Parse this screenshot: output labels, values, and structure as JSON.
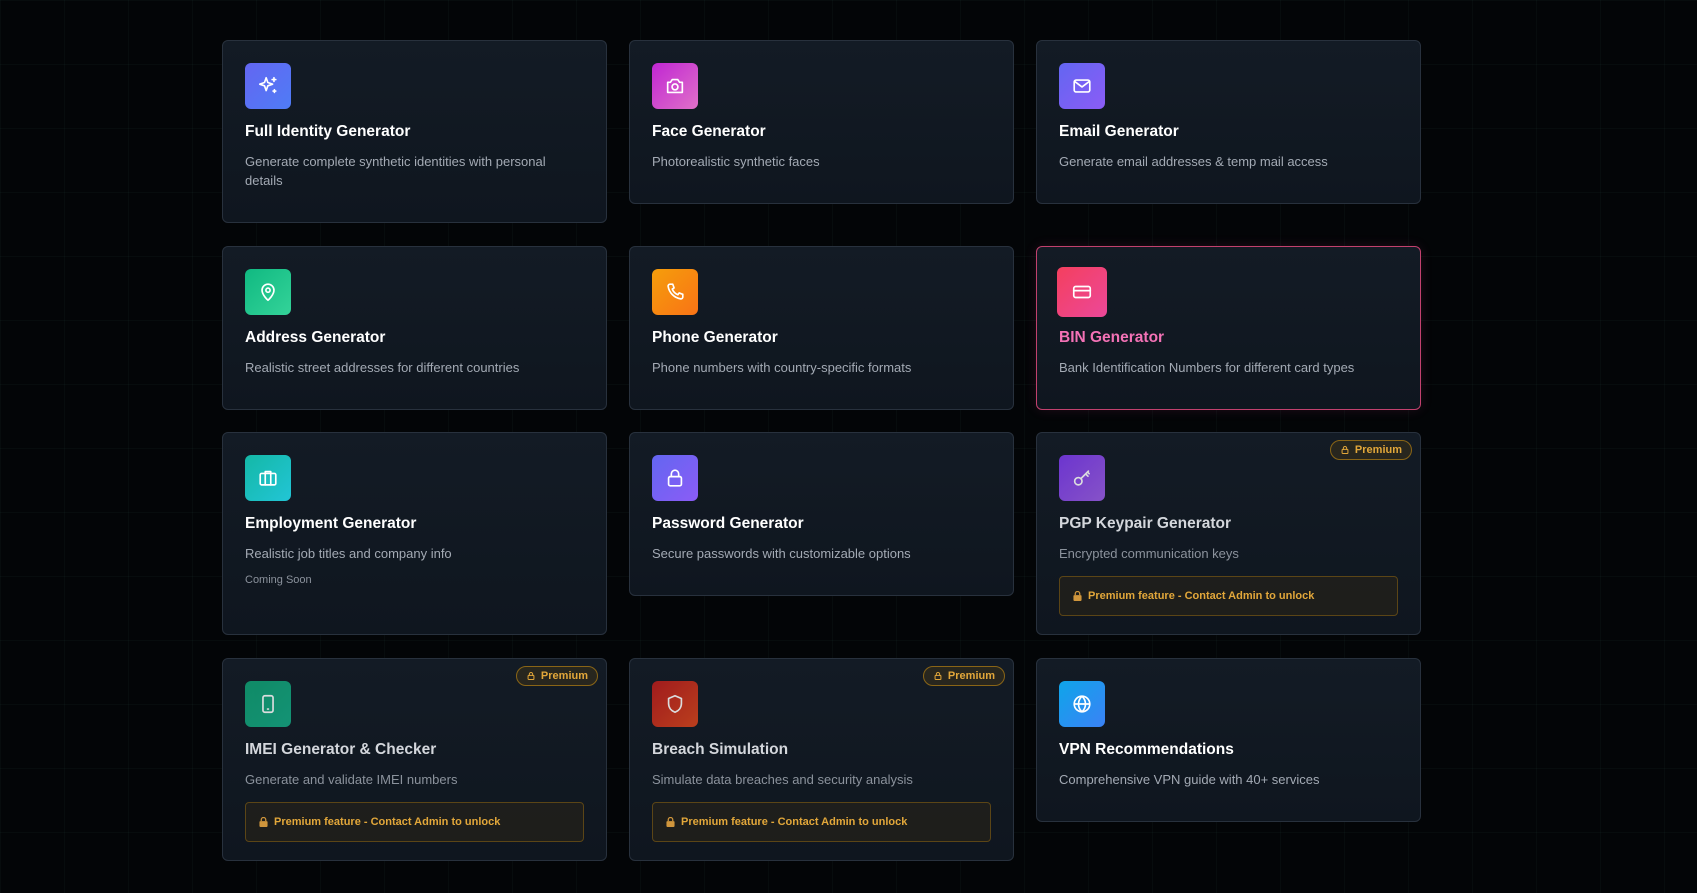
{
  "colors": {
    "page_background": "#030507",
    "card_background": "#121a24",
    "card_border": "#28313d",
    "highlight_border": "#c2416e",
    "highlight_title": "#f472b6",
    "premium_accent": "#e2a73a"
  },
  "cards": [
    {
      "title": "Full Identity Generator",
      "description": "Generate complete synthetic identities with personal details",
      "icon": "sparkles-icon",
      "icon_gradient": [
        "#6366f1",
        "#4f7cf6"
      ]
    },
    {
      "title": "Face Generator",
      "description": "Photorealistic synthetic faces",
      "icon": "camera-icon",
      "icon_gradient": [
        "#c026d3",
        "#e070c8"
      ]
    },
    {
      "title": "Email Generator",
      "description": "Generate email addresses & temp mail access",
      "icon": "mail-icon",
      "icon_gradient": [
        "#6366f1",
        "#8b5cf6"
      ]
    },
    {
      "title": "Address Generator",
      "description": "Realistic street addresses for different countries",
      "icon": "map-pin-icon",
      "icon_gradient": [
        "#10b981",
        "#34d399"
      ]
    },
    {
      "title": "Phone Generator",
      "description": "Phone numbers with country-specific formats",
      "icon": "phone-icon",
      "icon_gradient": [
        "#f59e0b",
        "#f97316"
      ]
    },
    {
      "title": "BIN Generator",
      "description": "Bank Identification Numbers for different card types",
      "icon": "credit-card-icon",
      "icon_gradient": [
        "#f43f5e",
        "#ec4899"
      ],
      "highlighted": true
    },
    {
      "title": "Employment Generator",
      "description": "Realistic job titles and company info",
      "icon": "briefcase-icon",
      "icon_gradient": [
        "#14b8a6",
        "#22c5d6"
      ],
      "status": "Coming Soon"
    },
    {
      "title": "Password Generator",
      "description": "Secure passwords with customizable options",
      "icon": "lock-icon",
      "icon_gradient": [
        "#6366f1",
        "#8b5cf6"
      ]
    },
    {
      "title": "PGP Keypair Generator",
      "description": "Encrypted communication keys",
      "icon": "key-icon",
      "icon_gradient": [
        "#7c3aed",
        "#9b5de5"
      ],
      "premium": true,
      "badge": "Premium",
      "lock_message": "Premium feature - Contact Admin to unlock"
    },
    {
      "title": "IMEI Generator & Checker",
      "description": "Generate and validate IMEI numbers",
      "icon": "smartphone-icon",
      "icon_gradient": [
        "#0f9f72",
        "#15a884"
      ],
      "premium": true,
      "badge": "Premium",
      "lock_message": "Premium feature - Contact Admin to unlock"
    },
    {
      "title": "Breach Simulation",
      "description": "Simulate data breaches and security analysis",
      "icon": "shield-icon",
      "icon_gradient": [
        "#b91c1c",
        "#d9461c"
      ],
      "premium": true,
      "badge": "Premium",
      "lock_message": "Premium feature - Contact Admin to unlock"
    },
    {
      "title": "VPN Recommendations",
      "description": "Comprehensive VPN guide with 40+ services",
      "icon": "globe-icon",
      "icon_gradient": [
        "#0ea5e9",
        "#3b82f6"
      ]
    }
  ]
}
